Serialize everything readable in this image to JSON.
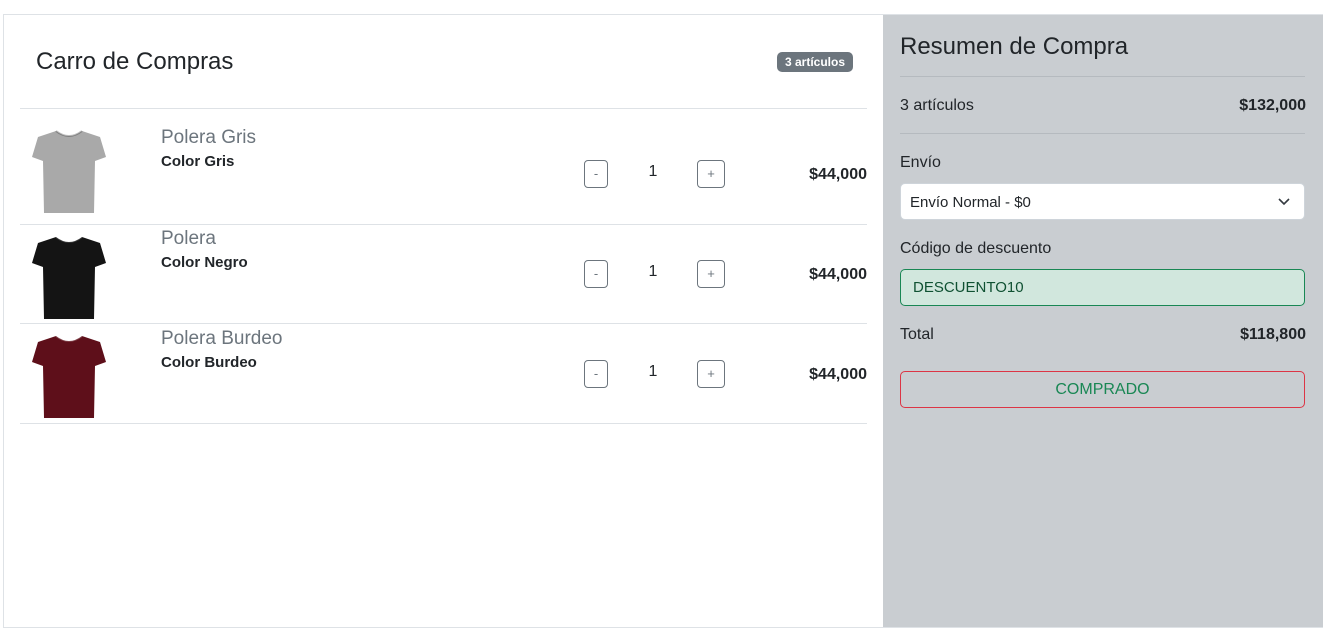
{
  "cart": {
    "title": "Carro de Compras",
    "badge": "3 artículos",
    "items": [
      {
        "name": "Polera Gris",
        "color_label": "Color Gris",
        "qty": "1",
        "price": "$44,000",
        "minus": "-",
        "plus": "+",
        "shirt_color": "#a9a9a9"
      },
      {
        "name": "Polera",
        "color_label": "Color Negro",
        "qty": "1",
        "price": "$44,000",
        "minus": "-",
        "plus": "+",
        "shirt_color": "#141414"
      },
      {
        "name": "Polera Burdeo",
        "color_label": "Color Burdeo",
        "qty": "1",
        "price": "$44,000",
        "minus": "-",
        "plus": "+",
        "shirt_color": "#5e0f1a"
      }
    ]
  },
  "summary": {
    "title": "Resumen de Compra",
    "items_label": "3 artículos",
    "items_total": "$132,000",
    "shipping_label": "Envío",
    "shipping_value": "Envío Normal - $0",
    "discount_label": "Código de descuento",
    "discount_value": "DESCUENTO10",
    "total_label": "Total",
    "total_value": "$118,800",
    "button_label": "COMPRADO"
  },
  "colors": {
    "summary_bg": "#c9cdd1",
    "badge_bg": "#6c757d",
    "discount_bg": "#d1e7dd",
    "success": "#198754",
    "danger": "#dc3545"
  }
}
